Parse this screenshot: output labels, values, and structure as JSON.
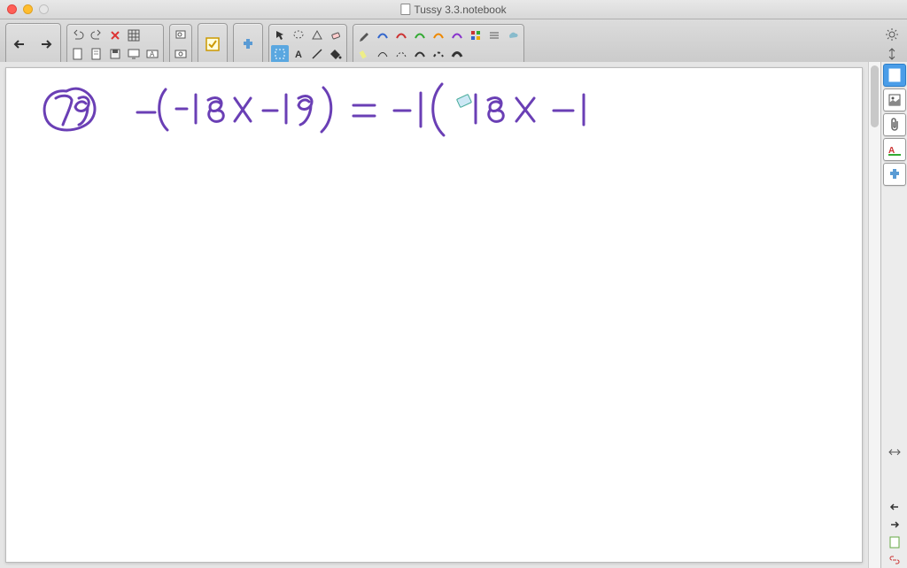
{
  "window": {
    "title": "Tussy 3.3.notebook"
  },
  "handwriting": {
    "problem_number": "79",
    "equation": "-(-18x - 19) = -1(-18x - 1",
    "color": "#6a3fb5"
  },
  "toolbar": {
    "nav": {
      "back": "←",
      "forward": "→"
    },
    "file_row1": [
      "undo",
      "redo",
      "delete",
      "table"
    ],
    "file_row2": [
      "new",
      "open",
      "save",
      "screen",
      "text-box"
    ],
    "screen": [
      "screen-shade",
      "checkbox"
    ],
    "addon": "puzzle",
    "select_row1": [
      "pointer",
      "lasso",
      "shape",
      "eraser"
    ],
    "select_row2": [
      "marquee",
      "text",
      "line",
      "fill"
    ],
    "pens_row1": [
      "pen",
      "stroke-blue",
      "stroke-red",
      "stroke-green",
      "stroke-orange",
      "stroke-purple",
      "palette",
      "settings",
      "cloud"
    ],
    "pens_row2": [
      "highlighter",
      "dash1",
      "dash2",
      "dash3",
      "dash4",
      "dash5"
    ],
    "right": [
      "gear",
      "resize"
    ]
  },
  "side": {
    "tabs": [
      "page",
      "gallery",
      "attach",
      "text-style",
      "addons"
    ],
    "bottom": [
      "expand",
      "prev",
      "next",
      "doc",
      "link"
    ]
  }
}
